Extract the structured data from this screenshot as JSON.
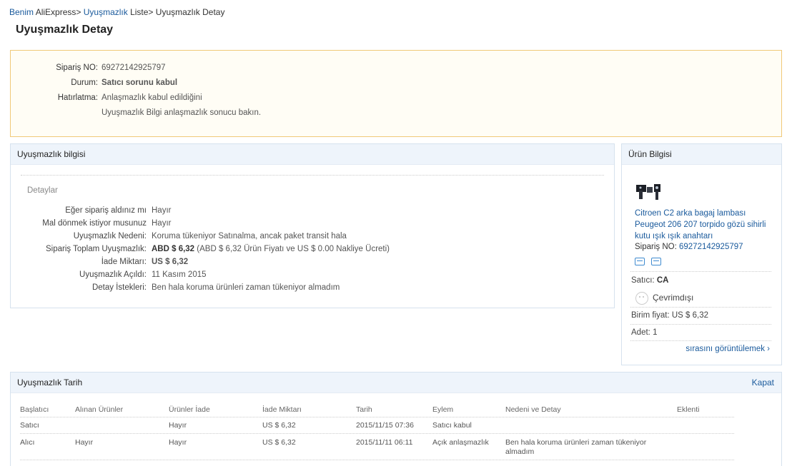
{
  "breadcrumb": {
    "home": "Benim",
    "home_suffix": " AliExpress>",
    "list": "Uyuşmazlık",
    "list_suffix": " Liste>",
    "current": " Uyuşmazlık Detay"
  },
  "page_title": "Uyuşmazlık Detay",
  "status": {
    "order_label": "Sipariş NO:",
    "order_value": "69272142925797",
    "state_label": "Durum:",
    "state_value": "Satıcı sorunu kabul",
    "reminder_label": "Hatırlatma:",
    "reminder_line1": "Anlaşmazlık kabul edildiğini",
    "reminder_line2": "Uyuşmazlık Bilgi anlaşmazlık sonucu bakın."
  },
  "dispute": {
    "title": "Uyuşmazlık bilgisi",
    "details_label": "Detaylar",
    "rows": [
      {
        "label": "Eğer sipariş aldınız mı",
        "value": "Hayır"
      },
      {
        "label": "Mal dönmek istiyor musunuz",
        "value": "Hayır"
      },
      {
        "label": "Uyuşmazlık Nedeni:",
        "value": "Koruma tükeniyor Satınalma, ancak paket transit hala"
      },
      {
        "label": "Sipariş Toplam Uyuşmazlık:",
        "value_bold": "ABD $ 6,32",
        "value": " (ABD $ 6,32 Ürün Fiyatı ve US $ 0.00 Nakliye Ücreti)"
      },
      {
        "label": "İade Miktarı:",
        "value_orange": "US $ 6,32"
      },
      {
        "label": "Uyuşmazlık Açıldı:",
        "value": "11 Kasım 2015"
      },
      {
        "label": "Detay İstekleri:",
        "value": "Ben hala koruma ürünleri zaman tükeniyor almadım"
      }
    ]
  },
  "product": {
    "title": "Ürün Bilgisi",
    "name": "Citroen C2 arka bagaj lambası Peugeot 206 207 torpido gözü sihirli kutu ışık ışık anahtarı",
    "order_label": "Sipariş NO:",
    "order_value": "69272142925797",
    "icons": [
      "delivery-icon",
      "card-icon"
    ],
    "seller_label": "Satıcı:",
    "seller_value": "CA",
    "online_status": "Çevrimdışı",
    "unit_price_label": "Birim fiyat:",
    "unit_price_value": "US $ 6,32",
    "qty_label": "Adet:",
    "qty_value": "1",
    "view_order": "sırasını görüntülemek ›"
  },
  "history": {
    "title": "Uyuşmazlık Tarih",
    "close": "Kapat",
    "columns": [
      "Başlatıcı",
      "Alınan Ürünler",
      "Ürünler İade",
      "İade Miktarı",
      "Tarih",
      "Eylem",
      "Nedeni ve Detay",
      "Eklenti"
    ],
    "rows": [
      [
        "Satıcı",
        "",
        "Hayır",
        "US $ 6,32",
        "2015/11/15 07:36",
        "Satıcı kabul",
        "",
        ""
      ],
      [
        "Alıcı",
        "Hayır",
        "Hayır",
        "US $ 6,32",
        "2015/11/11 06:11",
        "Açık anlaşmazlık",
        "Ben hala koruma ürünleri zaman tükeniyor almadım",
        ""
      ]
    ]
  },
  "colors": {
    "link": "#1a5a9c",
    "status_green": "#2b8a1e",
    "refund_orange": "#e8560c",
    "panel_head": "#eef4fb",
    "status_border": "#f0c978"
  }
}
